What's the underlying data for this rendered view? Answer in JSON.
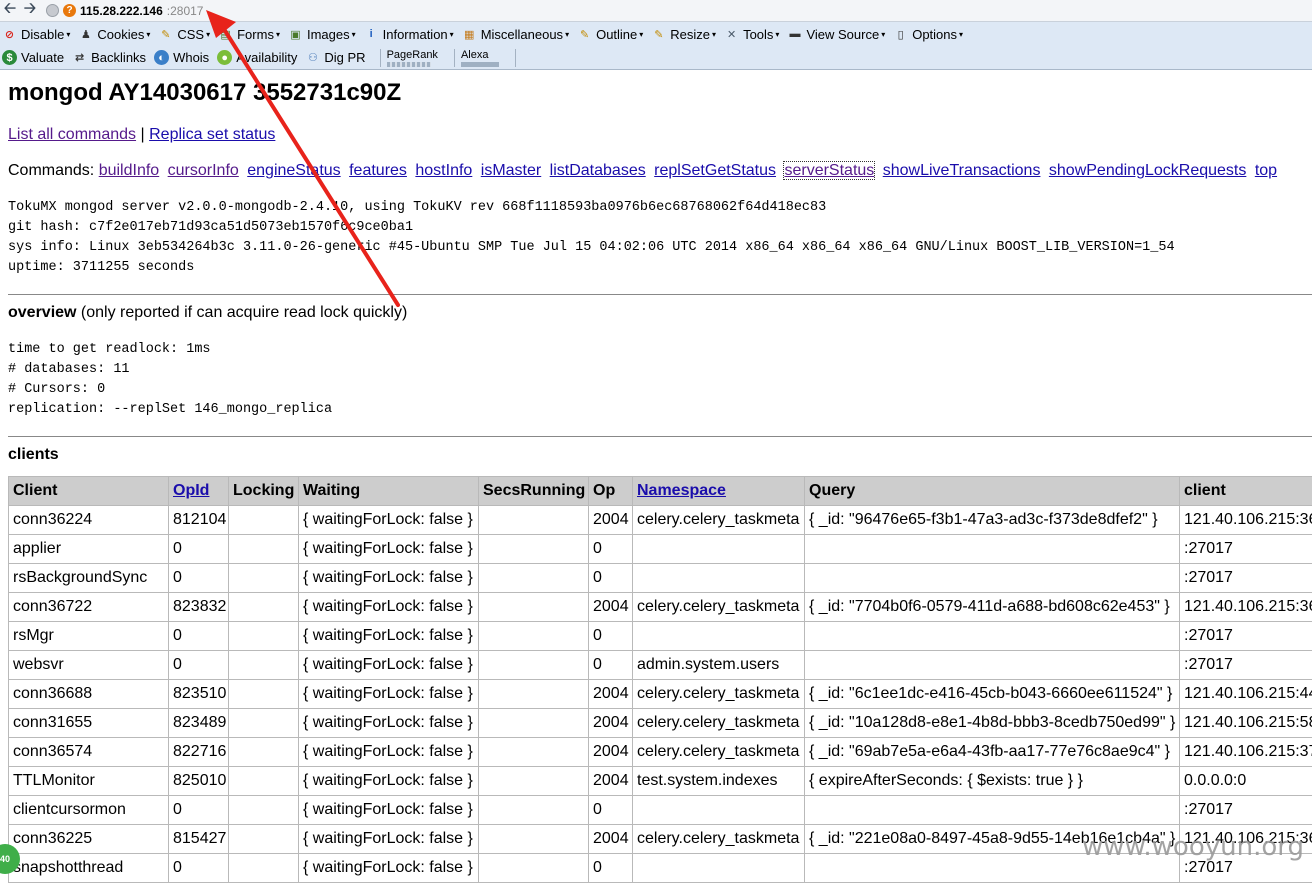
{
  "browser": {
    "url_host": "115.28.222.146",
    "url_port": ":28017"
  },
  "toolbar1": [
    {
      "label": "Disable",
      "icon": "disable-icon",
      "color": "#d9241c",
      "glyph": "⊘"
    },
    {
      "label": "Cookies",
      "icon": "cookies-icon",
      "color": "#333333",
      "glyph": "♟"
    },
    {
      "label": "CSS",
      "icon": "css-icon",
      "color": "#c28a00",
      "glyph": "✎"
    },
    {
      "label": "Forms",
      "icon": "forms-icon",
      "color": "#4a7a2a",
      "glyph": "▤"
    },
    {
      "label": "Images",
      "icon": "images-icon",
      "color": "#4a7a2a",
      "glyph": "▣"
    },
    {
      "label": "Information",
      "icon": "information-icon",
      "color": "#1f5fbf",
      "glyph": "i"
    },
    {
      "label": "Miscellaneous",
      "icon": "miscellaneous-icon",
      "color": "#c47a1a",
      "glyph": "▦"
    },
    {
      "label": "Outline",
      "icon": "outline-icon",
      "color": "#c28a00",
      "glyph": "✎"
    },
    {
      "label": "Resize",
      "icon": "resize-icon",
      "color": "#c28a00",
      "glyph": "✎"
    },
    {
      "label": "Tools",
      "icon": "tools-icon",
      "color": "#4a5a6a",
      "glyph": "✕"
    },
    {
      "label": "View Source",
      "icon": "view-source-icon",
      "color": "#333333",
      "glyph": "▬"
    },
    {
      "label": "Options",
      "icon": "options-icon",
      "color": "#333333",
      "glyph": "▯"
    }
  ],
  "toolbar2": {
    "valuate": "Valuate",
    "backlinks": "Backlinks",
    "whois": "Whois",
    "availability": "Availability",
    "digpr": "Dig PR",
    "pagerank": "PageRank",
    "alexa": "Alexa"
  },
  "page": {
    "title": "mongod AY14030617 3552731c90Z",
    "link_list_commands": "List all commands",
    "link_separator": "|",
    "link_replica_status": "Replica set status",
    "commands_label": "Commands:",
    "commands": [
      "buildInfo",
      "cursorInfo",
      "engineStatus",
      "features",
      "hostInfo",
      "isMaster",
      "listDatabases",
      "replSetGetStatus",
      "serverStatus",
      "showLiveTransactions",
      "showPendingLockRequests",
      "top"
    ],
    "server_info": "TokuMX mongod server v2.0.0-mongodb-2.4.10, using TokuKV rev 668f1118593ba0976b6ec68768062f64d418ec83\ngit hash: c7f2e017eb71d93ca51d5073eb1570f6c9ce0ba1\nsys info: Linux 3eb534264b3c 3.11.0-26-generic #45-Ubuntu SMP Tue Jul 15 04:02:06 UTC 2014 x86_64 x86_64 x86_64 GNU/Linux BOOST_LIB_VERSION=1_54\nuptime: 3711255 seconds",
    "overview_bold": "overview",
    "overview_note": " (only reported if can acquire read lock quickly)",
    "overview_info": "time to get readlock: 1ms\n# databases: 11\n# Cursors: 0\nreplication: --replSet 146_mongo_replica",
    "clients_heading": "clients"
  },
  "clients_table": {
    "headers": [
      "Client",
      "OpId",
      "Locking",
      "Waiting",
      "SecsRunning",
      "Op",
      "Namespace",
      "Query",
      "client"
    ],
    "rows": [
      [
        "conn36224",
        "812104",
        "",
        "{ waitingForLock: false }",
        "",
        "2004",
        "celery.celery_taskmeta",
        "{ _id: \"96476e65-f3b1-47a3-ad3c-f373de8dfef2\" }",
        "121.40.106.215:36"
      ],
      [
        "applier",
        "0",
        "",
        "{ waitingForLock: false }",
        "",
        "0",
        "",
        "",
        ":27017"
      ],
      [
        "rsBackgroundSync",
        "0",
        "",
        "{ waitingForLock: false }",
        "",
        "0",
        "",
        "",
        ":27017"
      ],
      [
        "conn36722",
        "823832",
        "",
        "{ waitingForLock: false }",
        "",
        "2004",
        "celery.celery_taskmeta",
        "{ _id: \"7704b0f6-0579-411d-a688-bd608c62e453\" }",
        "121.40.106.215:36"
      ],
      [
        "rsMgr",
        "0",
        "",
        "{ waitingForLock: false }",
        "",
        "0",
        "",
        "",
        ":27017"
      ],
      [
        "websvr",
        "0",
        "",
        "{ waitingForLock: false }",
        "",
        "0",
        "admin.system.users",
        "",
        ":27017"
      ],
      [
        "conn36688",
        "823510",
        "",
        "{ waitingForLock: false }",
        "",
        "2004",
        "celery.celery_taskmeta",
        "{ _id: \"6c1ee1dc-e416-45cb-b043-6660ee611524\" }",
        "121.40.106.215:44"
      ],
      [
        "conn31655",
        "823489",
        "",
        "{ waitingForLock: false }",
        "",
        "2004",
        "celery.celery_taskmeta",
        "{ _id: \"10a128d8-e8e1-4b8d-bbb3-8cedb750ed99\" }",
        "121.40.106.215:58"
      ],
      [
        "conn36574",
        "822716",
        "",
        "{ waitingForLock: false }",
        "",
        "2004",
        "celery.celery_taskmeta",
        "{ _id: \"69ab7e5a-e6a4-43fb-aa17-77e76c8ae9c4\" }",
        "121.40.106.215:37"
      ],
      [
        "TTLMonitor",
        "825010",
        "",
        "{ waitingForLock: false }",
        "",
        "2004",
        "test.system.indexes",
        "{ expireAfterSeconds: { $exists: true } }",
        "0.0.0.0:0"
      ],
      [
        "clientcursormon",
        "0",
        "",
        "{ waitingForLock: false }",
        "",
        "0",
        "",
        "",
        ":27017"
      ],
      [
        "conn36225",
        "815427",
        "",
        "{ waitingForLock: false }",
        "",
        "2004",
        "celery.celery_taskmeta",
        "{ _id: \"221e08a0-8497-45a8-9d55-14eb16e1cb4a\" }",
        "121.40.106.215:36"
      ],
      [
        "snapshotthread",
        "0",
        "",
        "{ waitingForLock: false }",
        "",
        "0",
        "",
        "",
        ":27017"
      ]
    ]
  },
  "watermark": "www.wooyun.org",
  "badge": "40",
  "annotation_color": "#e8231b"
}
